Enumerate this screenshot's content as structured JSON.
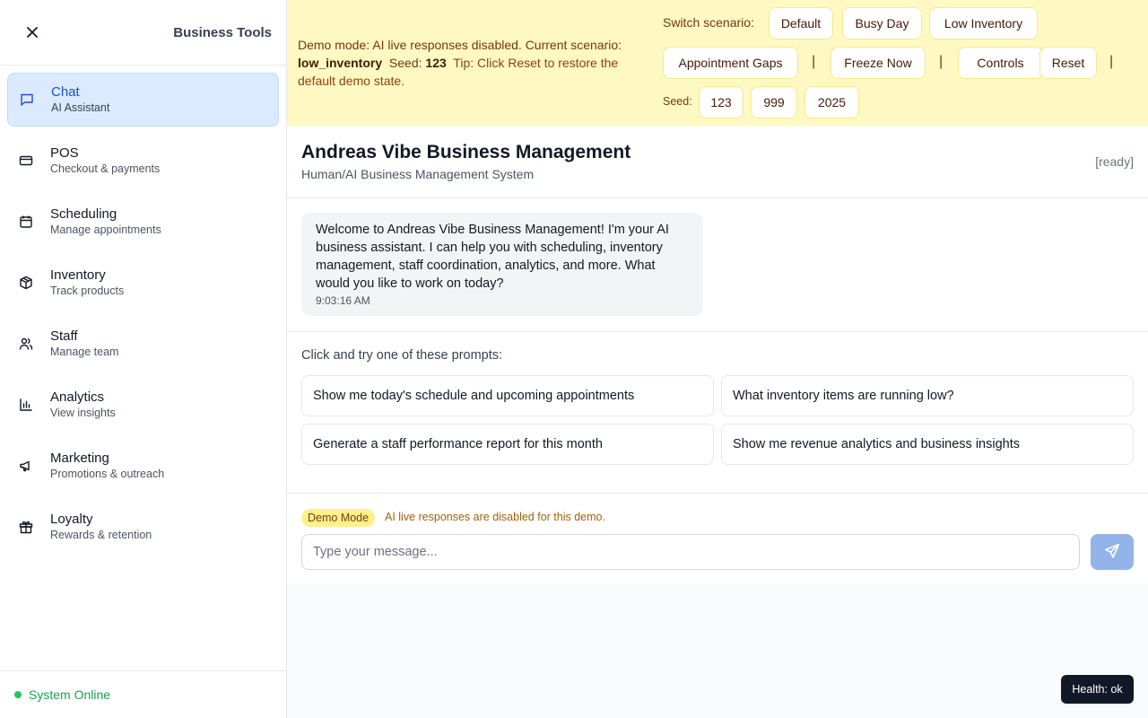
{
  "sidebar": {
    "title": "Business Tools",
    "items": [
      {
        "label": "Chat",
        "sub": "AI Assistant",
        "icon": "chat-icon"
      },
      {
        "label": "POS",
        "sub": "Checkout & payments",
        "icon": "credit-card-icon"
      },
      {
        "label": "Scheduling",
        "sub": "Manage appointments",
        "icon": "calendar-icon"
      },
      {
        "label": "Inventory",
        "sub": "Track products",
        "icon": "package-icon"
      },
      {
        "label": "Staff",
        "sub": "Manage team",
        "icon": "users-icon"
      },
      {
        "label": "Analytics",
        "sub": "View insights",
        "icon": "bar-chart-icon"
      },
      {
        "label": "Marketing",
        "sub": "Promotions & outreach",
        "icon": "megaphone-icon"
      },
      {
        "label": "Loyalty",
        "sub": "Rewards & retention",
        "icon": "gift-icon"
      }
    ],
    "status": "System Online"
  },
  "banner": {
    "msg_prefix": "Demo mode: AI live responses disabled. Current scenario:",
    "scenario": "low_inventory",
    "seed_label": "Seed:",
    "seed": "123",
    "tip": "Tip: Click Reset to restore the default demo state.",
    "switch_label": "Switch scenario:",
    "scenarios": [
      "Default",
      "Busy Day",
      "Low Inventory",
      "Appointment Gaps"
    ],
    "freeze": "Freeze Now",
    "controls": "Controls",
    "reset": "Reset",
    "seed_small_label": "Seed:",
    "seeds": [
      "123",
      "999",
      "2025"
    ],
    "separator": "|"
  },
  "header": {
    "title": "Andreas Vibe Business Management",
    "subtitle": "Human/AI Business Management System",
    "status": "[ready]"
  },
  "chat": {
    "message": "Welcome to Andreas Vibe Business Management! I'm your AI business assistant. I can help you with scheduling, inventory management, staff coordination, analytics, and more. What would you like to work on today?",
    "time": "9:03:16 AM"
  },
  "prompts": {
    "title": "Click and try one of these prompts:",
    "items": [
      "Show me today's schedule and upcoming appointments",
      "What inventory items are running low?",
      "Generate a staff performance report for this month",
      "Show me revenue analytics and business insights"
    ]
  },
  "composer": {
    "badge": "Demo Mode",
    "note": "AI live responses are disabled for this demo.",
    "placeholder": "Type your message..."
  },
  "health": "Health: ok",
  "colors": {
    "accent": "#1d4ed8",
    "active_bg": "#dbeafe",
    "banner_bg": "#fef9c3",
    "online": "#22c55e",
    "send_button": "#93b4ea"
  }
}
